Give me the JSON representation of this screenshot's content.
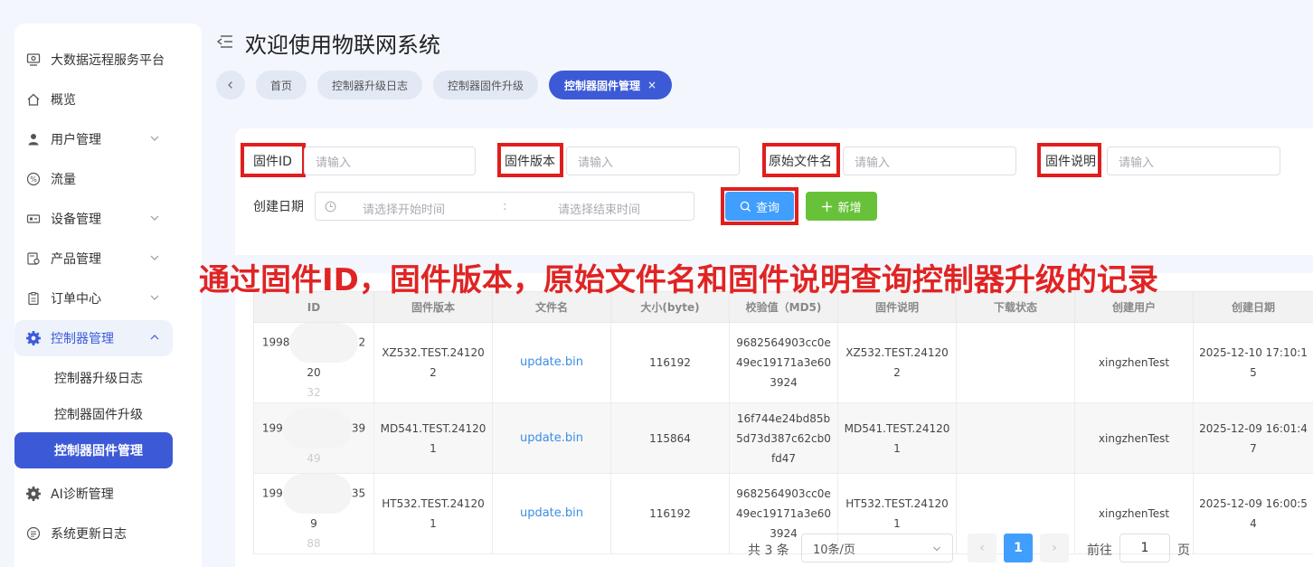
{
  "header": {
    "title": "欢迎使用物联网系统"
  },
  "tabs": [
    {
      "label": "首页"
    },
    {
      "label": "控制器升级日志"
    },
    {
      "label": "控制器固件升级"
    },
    {
      "label": "控制器固件管理",
      "close": "×"
    }
  ],
  "sidebar": {
    "items": [
      {
        "label": "大数据远程服务平台",
        "icon": "monitor-icon"
      },
      {
        "label": "概览",
        "icon": "home-icon"
      },
      {
        "label": "用户管理",
        "icon": "user-icon"
      },
      {
        "label": "流量",
        "icon": "percent-icon"
      },
      {
        "label": "设备管理",
        "icon": "device-icon"
      },
      {
        "label": "产品管理",
        "icon": "product-icon"
      },
      {
        "label": "订单中心",
        "icon": "clipboard-icon"
      },
      {
        "label": "控制器管理",
        "icon": "gear-icon"
      },
      {
        "label": "AI诊断管理",
        "icon": "gear-icon"
      },
      {
        "label": "系统更新日志",
        "icon": "list-icon"
      }
    ],
    "subitems": [
      {
        "label": "控制器升级日志"
      },
      {
        "label": "控制器固件升级"
      },
      {
        "label": "控制器固件管理"
      }
    ]
  },
  "filters": {
    "firmware_id_label": "固件ID",
    "firmware_version_label": "固件版本",
    "original_filename_label": "原始文件名",
    "firmware_desc_label": "固件说明",
    "placeholder": "请输入",
    "create_date_label": "创建日期",
    "start_placeholder": "请选择开始时间",
    "range_separator": ":",
    "end_placeholder": "请选择结束时间",
    "search_label": "查询",
    "add_label": "新增"
  },
  "annotation": "通过固件ID，固件版本，原始文件名和固件说明查询控制器升级的记录",
  "table": {
    "columns": [
      "ID",
      "固件版本",
      "文件名",
      "大小(byte)",
      "校验值（MD5)",
      "固件说明",
      "下载状态",
      "创建用户",
      "创建日期"
    ],
    "rows": [
      {
        "id_a": "1998",
        "id_b": "220",
        "id_c": "32",
        "version": "XZ532.TEST.241202",
        "filename": "update.bin",
        "size": "116192",
        "md5": "9682564903cc0e49ec19171a3e603924",
        "desc": "XZ532.TEST.241202",
        "status": "",
        "user": "xingzhenTest",
        "date": "2025-12-10 17:10:15"
      },
      {
        "id_a": "199",
        "id_b": "39",
        "id_c": "49",
        "version": "MD541.TEST.241201",
        "filename": "update.bin",
        "size": "115864",
        "md5": "16f744e24bd85b5d73d387c62cb0fd47",
        "desc": "MD541.TEST.241201",
        "status": "",
        "user": "xingzhenTest",
        "date": "2025-12-09 16:01:47"
      },
      {
        "id_a": "199",
        "id_b": "359",
        "id_c": "88",
        "version": "HT532.TEST.241201",
        "filename": "update.bin",
        "size": "116192",
        "md5": "9682564903cc0e49ec19171a3e603924",
        "desc": "HT532.TEST.241201",
        "status": "",
        "user": "xingzhenTest",
        "date": "2025-12-09 16:00:54"
      }
    ]
  },
  "pagination": {
    "total": "共 3 条",
    "page_size": "10条/页",
    "prev": "‹",
    "current": "1",
    "next": "›",
    "goto_label": "前往",
    "goto_value": "1",
    "page_suffix": "页"
  }
}
